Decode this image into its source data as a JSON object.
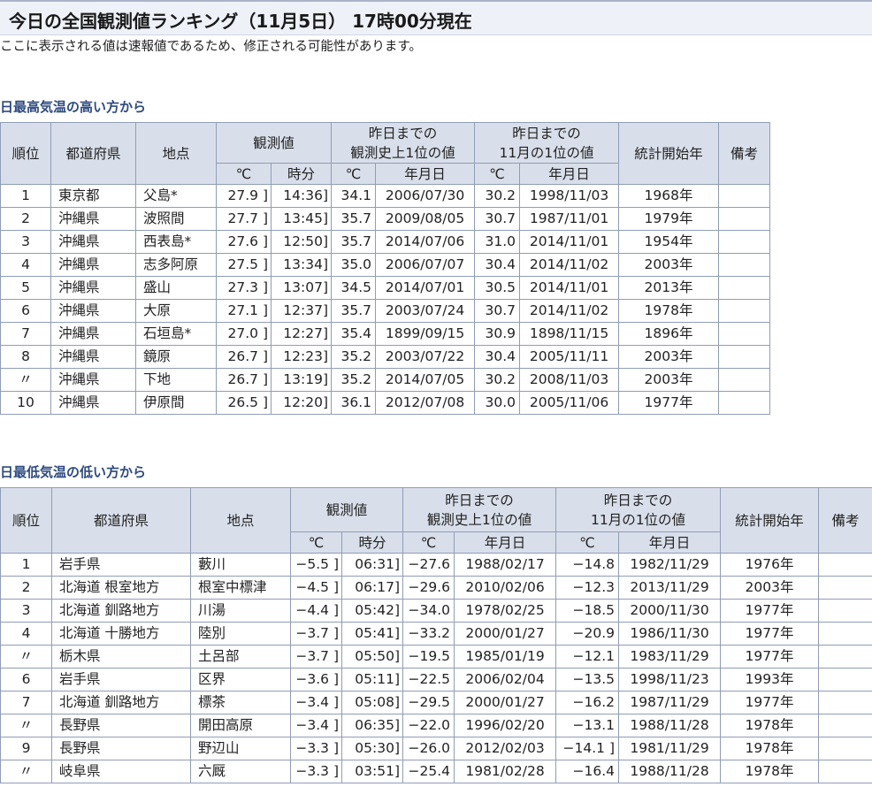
{
  "page": {
    "title": "今日の全国観測値ランキング（11月5日） 17時00分現在",
    "notice": "ここに表示される値は速報値であるため、修正される可能性があります。"
  },
  "headers": {
    "rank": "順位",
    "pref": "都道府県",
    "station": "地点",
    "obs": "観測値",
    "hist_max": "昨日までの\n観測史上1位の値",
    "month_max": "昨日までの\n11月の1位の値",
    "start": "統計開始年",
    "note": "備考",
    "deg": "℃",
    "time": "時分",
    "date": "年月日"
  },
  "high": {
    "title": "日最高気温の高い方から",
    "rows": [
      {
        "rank": "1",
        "pref": "東京都",
        "station": "父島*",
        "val": "27.9",
        "br": "]",
        "time": "14:36]",
        "hv": "34.1",
        "hd": "2006/07/30",
        "mv": "30.2",
        "md": "1998/11/03",
        "start": "1968年",
        "note": ""
      },
      {
        "rank": "2",
        "pref": "沖縄県",
        "station": "波照間",
        "val": "27.7",
        "br": "]",
        "time": "13:45]",
        "hv": "35.7",
        "hd": "2009/08/05",
        "mv": "30.7",
        "md": "1987/11/01",
        "start": "1979年",
        "note": ""
      },
      {
        "rank": "3",
        "pref": "沖縄県",
        "station": "西表島*",
        "val": "27.6",
        "br": "]",
        "time": "12:50]",
        "hv": "35.7",
        "hd": "2014/07/06",
        "mv": "31.0",
        "md": "2014/11/01",
        "start": "1954年",
        "note": ""
      },
      {
        "rank": "4",
        "pref": "沖縄県",
        "station": "志多阿原",
        "val": "27.5",
        "br": "]",
        "time": "13:34]",
        "hv": "35.0",
        "hd": "2006/07/07",
        "mv": "30.4",
        "md": "2014/11/02",
        "start": "2003年",
        "note": ""
      },
      {
        "rank": "5",
        "pref": "沖縄県",
        "station": "盛山",
        "val": "27.3",
        "br": "]",
        "time": "13:07]",
        "hv": "34.5",
        "hd": "2014/07/01",
        "mv": "30.5",
        "md": "2014/11/01",
        "start": "2013年",
        "note": ""
      },
      {
        "rank": "6",
        "pref": "沖縄県",
        "station": "大原",
        "val": "27.1",
        "br": "]",
        "time": "12:37]",
        "hv": "35.7",
        "hd": "2003/07/24",
        "mv": "30.7",
        "md": "2014/11/02",
        "start": "1978年",
        "note": ""
      },
      {
        "rank": "7",
        "pref": "沖縄県",
        "station": "石垣島*",
        "val": "27.0",
        "br": "]",
        "time": "12:27]",
        "hv": "35.4",
        "hd": "1899/09/15",
        "mv": "30.9",
        "md": "1898/11/15",
        "start": "1896年",
        "note": ""
      },
      {
        "rank": "8",
        "pref": "沖縄県",
        "station": "鏡原",
        "val": "26.7",
        "br": "]",
        "time": "12:23]",
        "hv": "35.2",
        "hd": "2003/07/22",
        "mv": "30.4",
        "md": "2005/11/11",
        "start": "2003年",
        "note": ""
      },
      {
        "rank": "〃",
        "pref": "沖縄県",
        "station": "下地",
        "val": "26.7",
        "br": "]",
        "time": "13:19]",
        "hv": "35.2",
        "hd": "2014/07/05",
        "mv": "30.2",
        "md": "2008/11/03",
        "start": "2003年",
        "note": ""
      },
      {
        "rank": "10",
        "pref": "沖縄県",
        "station": "伊原間",
        "val": "26.5",
        "br": "]",
        "time": "12:20]",
        "hv": "36.1",
        "hd": "2012/07/08",
        "mv": "30.0",
        "md": "2005/11/06",
        "start": "1977年",
        "note": ""
      }
    ]
  },
  "low": {
    "title": "日最低気温の低い方から",
    "rows": [
      {
        "rank": "1",
        "pref": "岩手県",
        "station": "藪川",
        "val": "−5.5",
        "br": "]",
        "time": "06:31]",
        "hv": "−27.6",
        "hd": "1988/02/17",
        "mv": "−14.8",
        "md": "1982/11/29",
        "start": "1976年",
        "note": ""
      },
      {
        "rank": "2",
        "pref": "北海道 根室地方",
        "station": "根室中標津",
        "val": "−4.5",
        "br": "]",
        "time": "06:17]",
        "hv": "−29.6",
        "hd": "2010/02/06",
        "mv": "−12.3",
        "md": "2013/11/29",
        "start": "2003年",
        "note": ""
      },
      {
        "rank": "3",
        "pref": "北海道 釧路地方",
        "station": "川湯",
        "val": "−4.4",
        "br": "]",
        "time": "05:42]",
        "hv": "−34.0",
        "hd": "1978/02/25",
        "mv": "−18.5",
        "md": "2000/11/30",
        "start": "1977年",
        "note": ""
      },
      {
        "rank": "4",
        "pref": "北海道 十勝地方",
        "station": "陸別",
        "val": "−3.7",
        "br": "]",
        "time": "05:41]",
        "hv": "−33.2",
        "hd": "2000/01/27",
        "mv": "−20.9",
        "md": "1986/11/30",
        "start": "1977年",
        "note": ""
      },
      {
        "rank": "〃",
        "pref": "栃木県",
        "station": "土呂部",
        "val": "−3.7",
        "br": "]",
        "time": "05:50]",
        "hv": "−19.5",
        "hd": "1985/01/19",
        "mv": "−12.1",
        "md": "1983/11/29",
        "start": "1977年",
        "note": ""
      },
      {
        "rank": "6",
        "pref": "岩手県",
        "station": "区界",
        "val": "−3.6",
        "br": "]",
        "time": "05:11]",
        "hv": "−22.5",
        "hd": "2006/02/04",
        "mv": "−13.5",
        "md": "1998/11/23",
        "start": "1993年",
        "note": ""
      },
      {
        "rank": "7",
        "pref": "北海道 釧路地方",
        "station": "標茶",
        "val": "−3.4",
        "br": "]",
        "time": "05:08]",
        "hv": "−29.5",
        "hd": "2000/01/27",
        "mv": "−16.2",
        "md": "1987/11/29",
        "start": "1977年",
        "note": ""
      },
      {
        "rank": "〃",
        "pref": "長野県",
        "station": "開田高原",
        "val": "−3.4",
        "br": "]",
        "time": "06:35]",
        "hv": "−22.0",
        "hd": "1996/02/20",
        "mv": "−13.1",
        "md": "1988/11/28",
        "start": "1978年",
        "note": ""
      },
      {
        "rank": "9",
        "pref": "長野県",
        "station": "野辺山",
        "val": "−3.3",
        "br": "]",
        "time": "05:30]",
        "hv": "−26.0",
        "hd": "2012/02/03",
        "mv": "−14.1 ]",
        "md": "1981/11/29",
        "start": "1978年",
        "note": ""
      },
      {
        "rank": "〃",
        "pref": "岐阜県",
        "station": "六厩",
        "val": "−3.3",
        "br": "]",
        "time": "03:51]",
        "hv": "−25.4",
        "hd": "1981/02/28",
        "mv": "−16.4",
        "md": "1988/11/28",
        "start": "1978年",
        "note": ""
      }
    ]
  }
}
